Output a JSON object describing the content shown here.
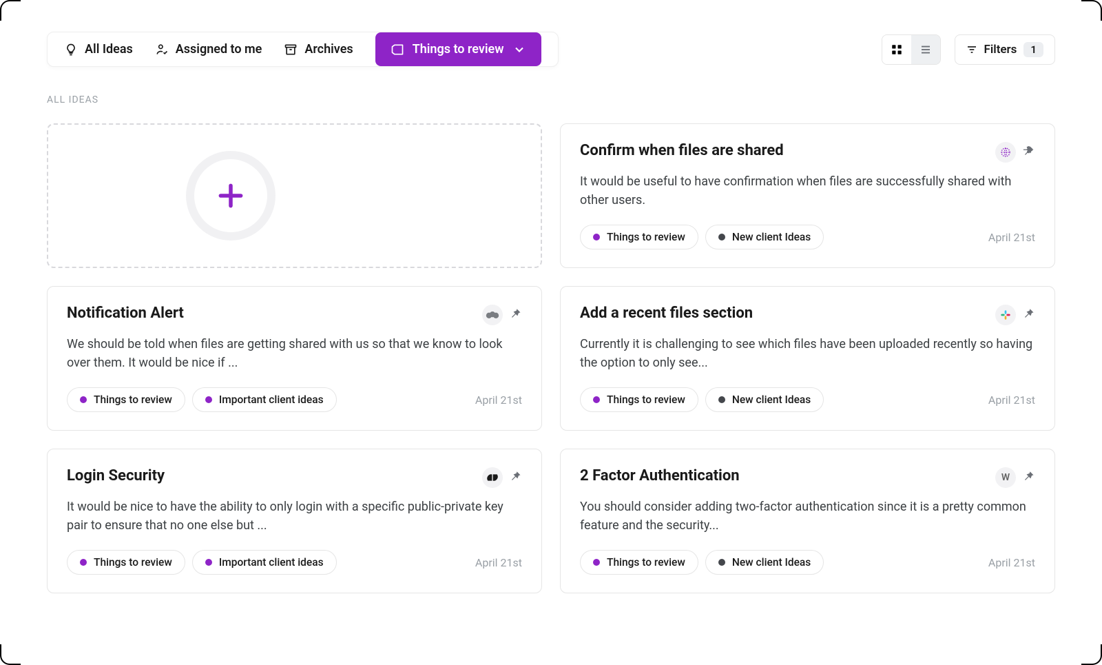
{
  "tabs": {
    "all_ideas": "All Ideas",
    "assigned": "Assigned to me",
    "archives": "Archives",
    "active": "Things to review"
  },
  "filters": {
    "label": "Filters",
    "count": "1"
  },
  "section_label": "ALL IDEAS",
  "colors": {
    "purple": "#8e24c7",
    "dark": "#44474c"
  },
  "cards": [
    {
      "title": "Confirm when files are shared",
      "desc": "It would be useful to have confirmation when files are successfully shared with other users.",
      "tags": [
        {
          "label": "Things to review",
          "color": "#8e24c7"
        },
        {
          "label": "New client Ideas",
          "color": "#44474c"
        }
      ],
      "date": "April 21st",
      "source": "globe-icon"
    },
    {
      "title": "Notification Alert",
      "desc": "We should be told when files are getting shared with us so that we know to look over them. It would be nice if ...",
      "tags": [
        {
          "label": "Things to review",
          "color": "#8e24c7"
        },
        {
          "label": "Important client ideas",
          "color": "#8e24c7"
        }
      ],
      "date": "April 21st",
      "source": "salesforce-icon"
    },
    {
      "title": "Add a recent files section",
      "desc": "Currently it is challenging to see which files have been uploaded recently so having the option to only see...",
      "tags": [
        {
          "label": "Things to review",
          "color": "#8e24c7"
        },
        {
          "label": "New client Ideas",
          "color": "#44474c"
        }
      ],
      "date": "April 21st",
      "source": "slack-icon"
    },
    {
      "title": "Login Security",
      "desc": "It would be nice to have the ability to only login with a specific public-private key pair to ensure that no one else but ...",
      "tags": [
        {
          "label": "Things to review",
          "color": "#8e24c7"
        },
        {
          "label": "Important client ideas",
          "color": "#8e24c7"
        }
      ],
      "date": "April 21st",
      "source": "zendesk-icon"
    },
    {
      "title": "2 Factor Authentication",
      "desc": "You should consider adding two-factor authentication since it is a pretty common feature and the security...",
      "tags": [
        {
          "label": "Things to review",
          "color": "#8e24c7"
        },
        {
          "label": "New client Ideas",
          "color": "#44474c"
        }
      ],
      "date": "April 21st",
      "source": "avatar-w",
      "avatar": "W"
    }
  ]
}
